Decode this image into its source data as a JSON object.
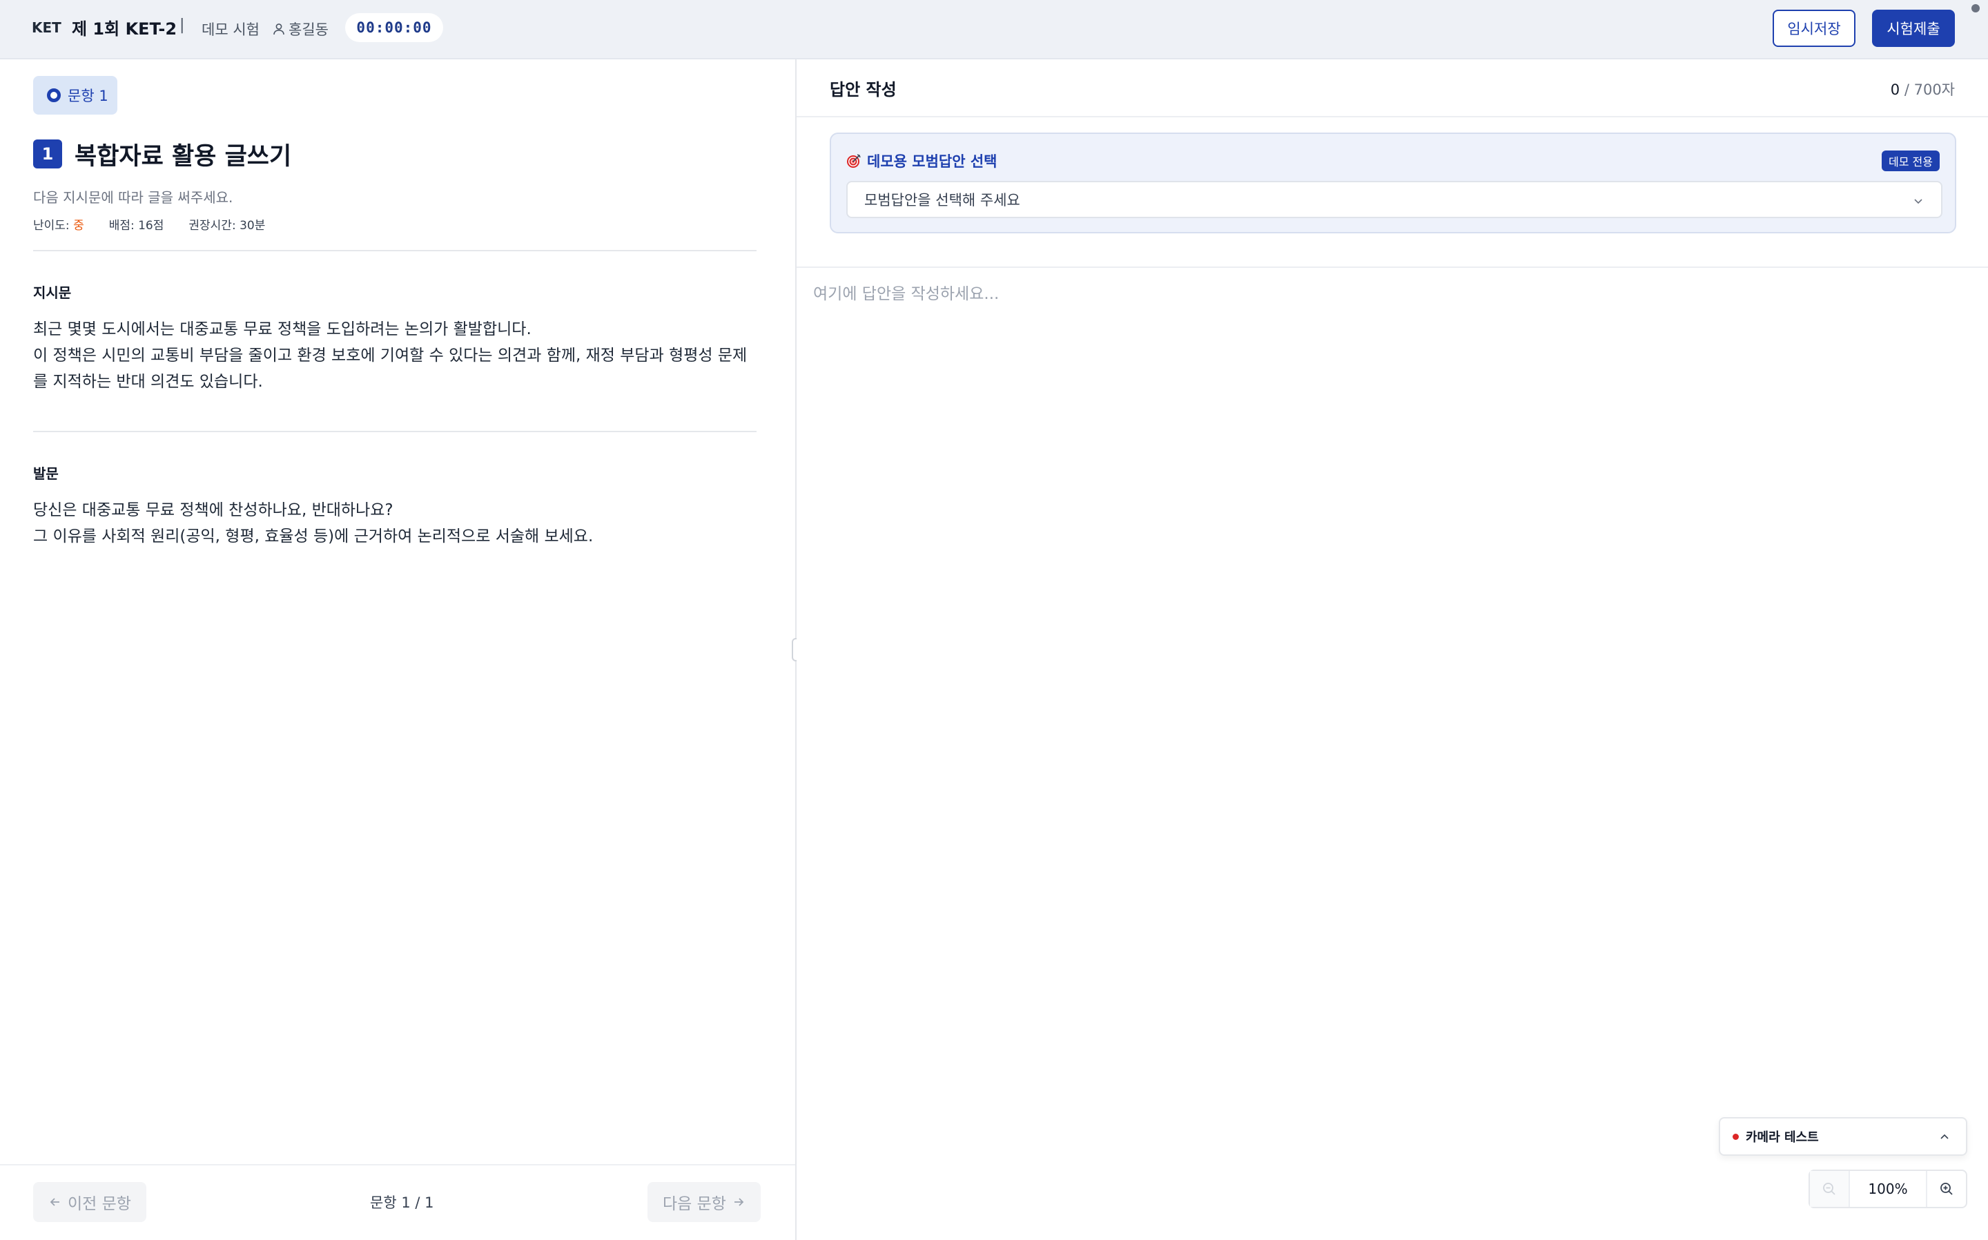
{
  "header": {
    "exam_code": "KET",
    "exam_title": "제 1회 KET-2",
    "separator": "|",
    "exam_type": "데모 시험",
    "user_name": "홍길동",
    "timer": "00:00:00",
    "save_label": "임시저장",
    "submit_label": "시험제출"
  },
  "question": {
    "tab_label": "문항 1",
    "number": "1",
    "title": "복합자료 활용 글쓰기",
    "subtitle": "다음 지시문에 따라 글을 써주세요.",
    "meta": {
      "difficulty_label": "난이도:",
      "difficulty_value": "중",
      "score": "배점: 16점",
      "time": "권장시간: 30분"
    },
    "instruction": {
      "label": "지시문",
      "line1": "최근 몇몇 도시에서는 대중교통 무료 정책을 도입하려는 논의가 활발합니다.",
      "line2": "이 정책은 시민의 교통비 부담을 줄이고 환경 보호에 기여할 수 있다는 의견과 함께, 재정 부담과 형평성 문제를 지적하는 반대 의견도 있습니다."
    },
    "prompt": {
      "label": "발문",
      "line1": "당신은 대중교통 무료 정책에 찬성하나요, 반대하나요?",
      "line2": "그 이유를 사회적 원리(공익, 형평, 효율성 등)에 근거하여 논리적으로 서술해 보세요."
    }
  },
  "pager": {
    "prev_label": "이전 문항",
    "next_label": "다음 문항",
    "position": "문항 1 / 1"
  },
  "answer": {
    "title": "답안 작성",
    "count_current": "0",
    "count_max": "/ 700자",
    "demo_title": "데모용 모범답안 선택",
    "demo_badge": "데모 전용",
    "demo_select_placeholder": "모범답안을 선택해 주세요",
    "editor_placeholder": "여기에 답안을 작성하세요..."
  },
  "camera": {
    "label": "카메라 테스트"
  },
  "zoom": {
    "level": "100%"
  },
  "colors": {
    "primary": "#1e40af",
    "header_bg": "#eef1f6",
    "difficulty": "#ea580c",
    "recording": "#dc2626"
  },
  "icons": [
    "user-icon",
    "radio-ring-icon",
    "target-icon",
    "chevron-down-icon",
    "chevron-up-icon",
    "arrow-left-icon",
    "arrow-right-icon",
    "zoom-out-icon",
    "zoom-in-icon"
  ]
}
